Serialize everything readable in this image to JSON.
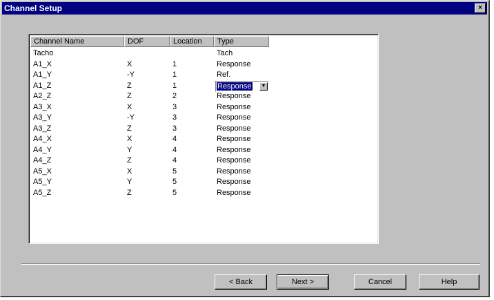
{
  "window": {
    "title": "Channel Setup",
    "close_glyph": "×"
  },
  "table": {
    "columns": [
      "Channel Name",
      "DOF",
      "Location",
      "Type"
    ],
    "rows": [
      [
        "Tacho",
        "",
        "",
        "Tach"
      ],
      [
        "A1_X",
        "X",
        "1",
        "Response"
      ],
      [
        "A1_Y",
        "-Y",
        "1",
        "Ref."
      ],
      [
        "A1_Z",
        "Z",
        "1",
        "Response"
      ],
      [
        "A2_Z",
        "Z",
        "2",
        "Response"
      ],
      [
        "A3_X",
        "X",
        "3",
        "Response"
      ],
      [
        "A3_Y",
        "-Y",
        "3",
        "Response"
      ],
      [
        "A3_Z",
        "Z",
        "3",
        "Response"
      ],
      [
        "A4_X",
        "X",
        "4",
        "Response"
      ],
      [
        "A4_Y",
        "Y",
        "4",
        "Response"
      ],
      [
        "A4_Z",
        "Z",
        "4",
        "Response"
      ],
      [
        "A5_X",
        "X",
        "5",
        "Response"
      ],
      [
        "A5_Y",
        "Y",
        "5",
        "Response"
      ],
      [
        "A5_Z",
        "Z",
        "5",
        "Response"
      ]
    ],
    "type_dropdown": {
      "selected": "Response",
      "row": 3
    }
  },
  "buttons": {
    "back": "< Back",
    "next": "Next >",
    "cancel": "Cancel",
    "help": "Help"
  },
  "colors": {
    "titlebar": "#000080",
    "dialog": "#c0c0c0",
    "selection": "#000080"
  }
}
